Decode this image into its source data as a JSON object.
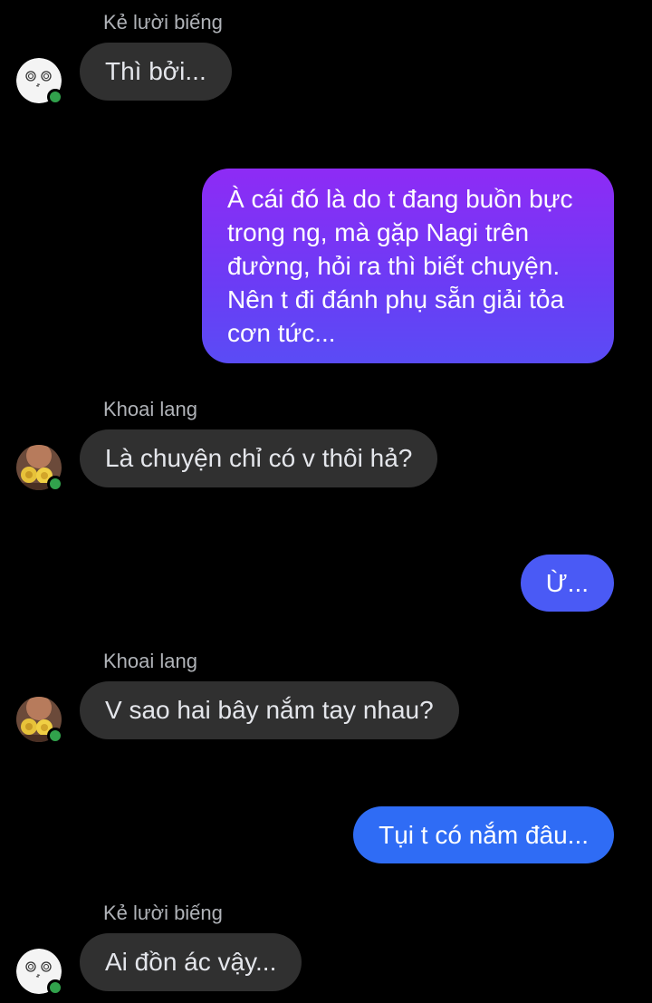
{
  "colors": {
    "background": "#000000",
    "incoming_bubble": "#303030",
    "incoming_text": "#e4e6eb",
    "sender_name": "#b0b3b8",
    "online_indicator": "#31a24c",
    "outgoing_gradient_top": "#8e2bf5",
    "outgoing_gradient_mid": "#5a4cf5",
    "outgoing_gradient_bottom": "#2f6cf5"
  },
  "messages": [
    {
      "direction": "incoming",
      "sender": "Kẻ lười biếng",
      "avatar": "white-doodle-face-avatar",
      "text": "Thì bởi..."
    },
    {
      "direction": "outgoing",
      "text": "À cái đó là do t đang buồn bực trong ng, mà gặp Nagi trên đường, hỏi ra thì biết chuyện. Nên t đi đánh phụ sẵn giải tỏa cơn tức..."
    },
    {
      "direction": "incoming",
      "sender": "Khoai lang",
      "avatar": "roasted-sweet-potato-avatar",
      "text": "Là chuyện chỉ có v thôi hả?"
    },
    {
      "direction": "outgoing",
      "text": "Ừ..."
    },
    {
      "direction": "incoming",
      "sender": "Khoai lang",
      "avatar": "roasted-sweet-potato-avatar",
      "text": "V sao hai bây nắm tay nhau?"
    },
    {
      "direction": "outgoing",
      "text": "Tụi t có nắm đâu..."
    },
    {
      "direction": "incoming",
      "sender": "Kẻ lười biếng",
      "avatar": "white-doodle-face-avatar",
      "text": "Ai đồn ác vậy..."
    }
  ]
}
